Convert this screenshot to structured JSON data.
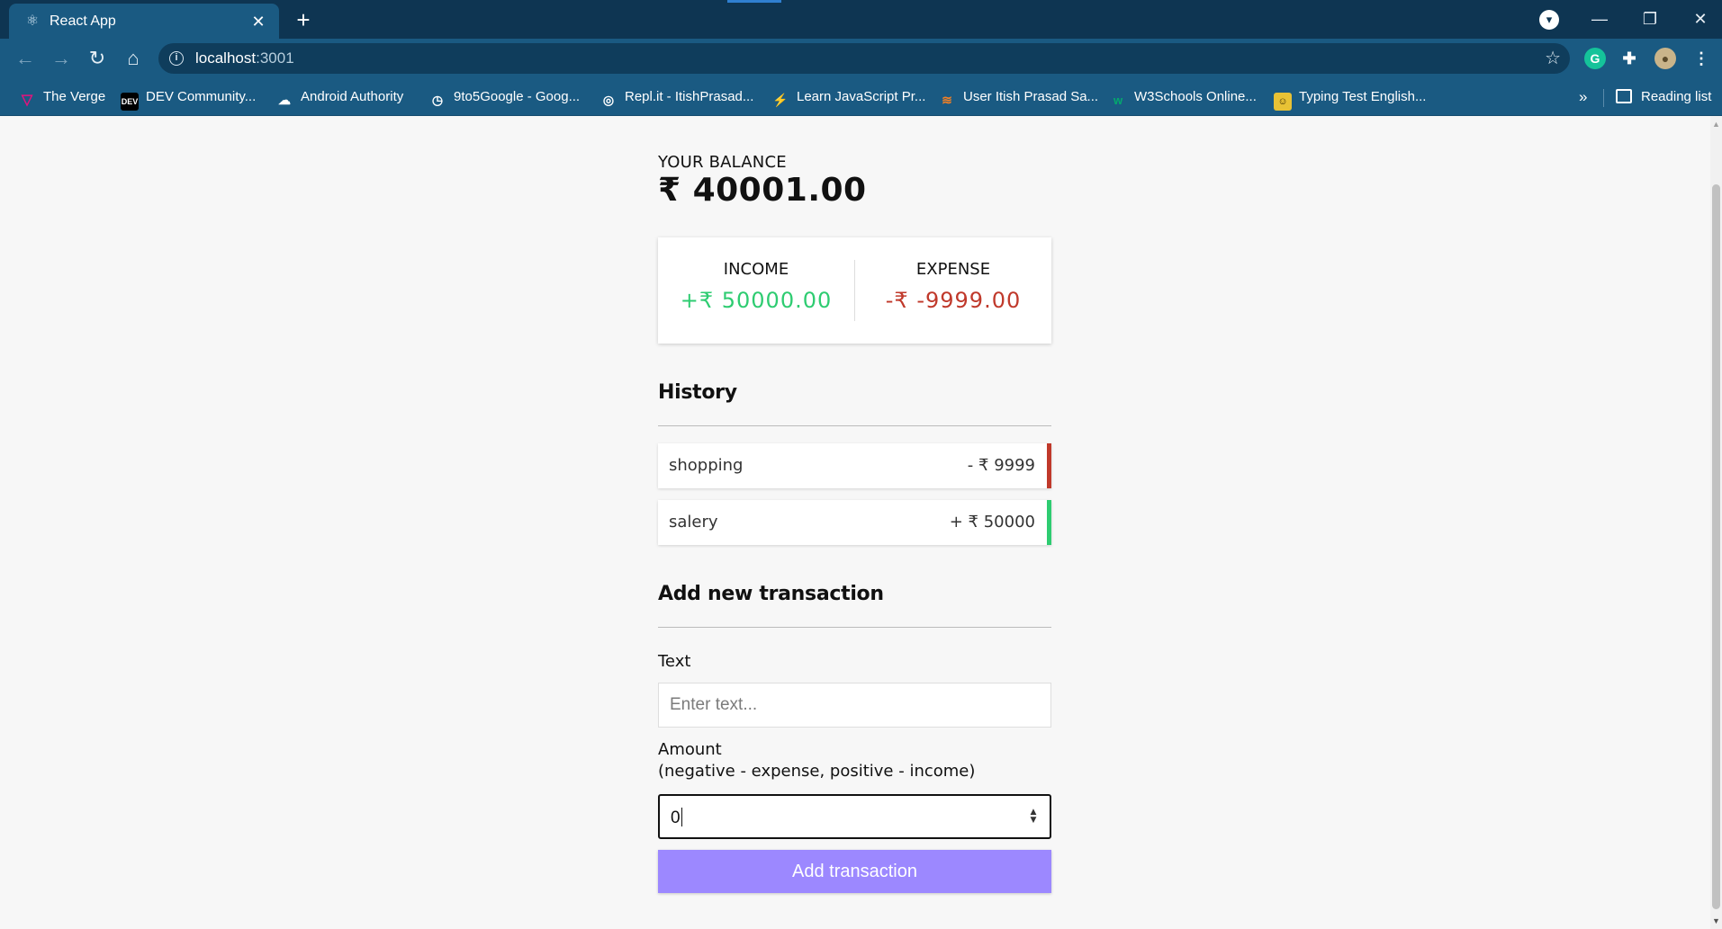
{
  "browser": {
    "tab_title": "React App",
    "tab_icon": "react-icon",
    "url_host": "localhost",
    "url_port": ":3001",
    "bookmarks": [
      {
        "label": "The Verge",
        "icon": "verge-icon",
        "color": "#e5127d"
      },
      {
        "label": "DEV Community...",
        "icon": "dev-icon",
        "color": "#000000"
      },
      {
        "label": "Android Authority",
        "icon": "android-authority-icon",
        "color": "#ffffff"
      },
      {
        "label": "9to5Google - Goog...",
        "icon": "clock-icon",
        "color": "#ffffff"
      },
      {
        "label": "Repl.it - ItishPrasad...",
        "icon": "replit-icon",
        "color": "#ffffff"
      },
      {
        "label": "Learn JavaScript Pr...",
        "icon": "scrimba-icon",
        "color": "#5b2bd5"
      },
      {
        "label": "User Itish Prasad Sa...",
        "icon": "stackoverflow-icon",
        "color": "#f48024"
      },
      {
        "label": "W3Schools Online...",
        "icon": "w3schools-icon",
        "color": "#04aa6d"
      },
      {
        "label": "Typing Test English...",
        "icon": "typing-icon",
        "color": "#e8c235"
      }
    ],
    "more_bookmarks": "»",
    "reading_list": "Reading list"
  },
  "app": {
    "balance_title": "YOUR BALANCE",
    "balance_amount": "₹ 40001.00",
    "income_label": "INCOME",
    "income_value": "+₹ 50000.00",
    "expense_label": "EXPENSE",
    "expense_value": "-₹ -9999.00",
    "history_heading": "History",
    "transactions": [
      {
        "text": "shopping",
        "amount": "- ₹ 9999",
        "type": "minus"
      },
      {
        "text": "salery",
        "amount": "+ ₹ 50000",
        "type": "plus"
      }
    ],
    "add_heading": "Add new transaction",
    "text_label": "Text",
    "text_placeholder": "Enter text...",
    "text_value": "",
    "amount_label": "Amount",
    "amount_hint": "(negative - expense, positive - income)",
    "amount_value": "0",
    "submit_label": "Add transaction"
  },
  "colors": {
    "income": "#2ecc71",
    "expense": "#c0392b",
    "button": "#9c88ff",
    "chrome_dark": "#0e3552",
    "chrome": "#1a5a82"
  }
}
